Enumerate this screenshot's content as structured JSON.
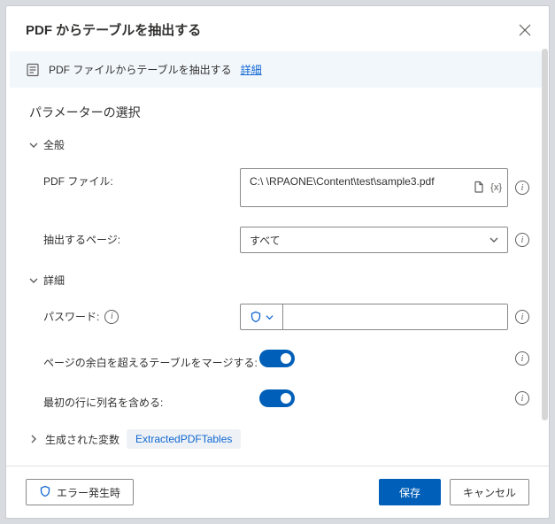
{
  "title": "PDF からテーブルを抽出する",
  "info": {
    "text": "PDF ファイルからテーブルを抽出する",
    "link": "詳細"
  },
  "paramsTitle": "パラメーターの選択",
  "sections": {
    "general": "全般",
    "detail": "詳細",
    "generated": "生成された変数"
  },
  "fields": {
    "pdfFile": {
      "label": "PDF ファイル:",
      "value": "C:\\                    \\RPAONE\\Content\\test\\sample3.pdf"
    },
    "pages": {
      "label": "抽出するページ:",
      "value": "すべて"
    },
    "password": {
      "label": "パスワード:",
      "value": ""
    },
    "merge": {
      "label": "ページの余白を超えるテーブルをマージする:"
    },
    "firstRow": {
      "label": "最初の行に列名を含める:"
    }
  },
  "varx": "{x}",
  "chip": "ExtractedPDFTables",
  "footer": {
    "onerror": "エラー発生時",
    "save": "保存",
    "cancel": "キャンセル"
  }
}
